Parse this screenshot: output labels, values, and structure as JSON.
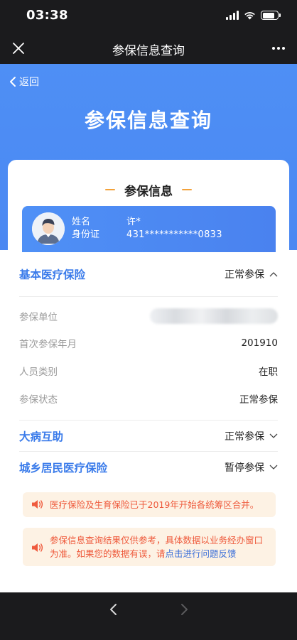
{
  "status_bar": {
    "time": "03:38"
  },
  "nav_bar": {
    "title": "参保信息查询"
  },
  "hero": {
    "back_label": "返回",
    "title": "参保信息查询"
  },
  "card": {
    "section_title": "参保信息",
    "person": {
      "name_label": "姓名",
      "id_label": "身份证",
      "name_value": "许*",
      "id_value": "431***********0833"
    }
  },
  "groups": [
    {
      "title": "基本医疗保险",
      "status": "正常参保",
      "expanded": true,
      "fields": [
        {
          "label": "参保单位",
          "value": ""
        },
        {
          "label": "首次参保年月",
          "value": "201910"
        },
        {
          "label": "人员类别",
          "value": "在职"
        },
        {
          "label": "参保状态",
          "value": "正常参保"
        }
      ]
    },
    {
      "title": "大病互助",
      "status": "正常参保",
      "expanded": false
    },
    {
      "title": "城乡居民医疗保险",
      "status": "暂停参保",
      "expanded": false
    }
  ],
  "notices": [
    {
      "text": "医疗保险及生育保险已于2019年开始各统筹区合并。"
    },
    {
      "text": "参保信息查询结果仅供参考，具体数据以业务经办窗口为准。如果您的数据有误，请",
      "link": "点击进行问题反馈"
    }
  ],
  "colors": {
    "primary": "#4a8af3",
    "accent_text": "#3a7bea",
    "notice_bg": "#fdf2e4",
    "notice_text": "#ee5a3c",
    "dash": "#f3a23a"
  },
  "icons": [
    "close-icon",
    "more-icon",
    "back-chevron-icon",
    "avatar-icon",
    "chevron-up-icon",
    "chevron-down-icon",
    "speaker-icon",
    "nav-back-icon",
    "nav-forward-icon"
  ]
}
